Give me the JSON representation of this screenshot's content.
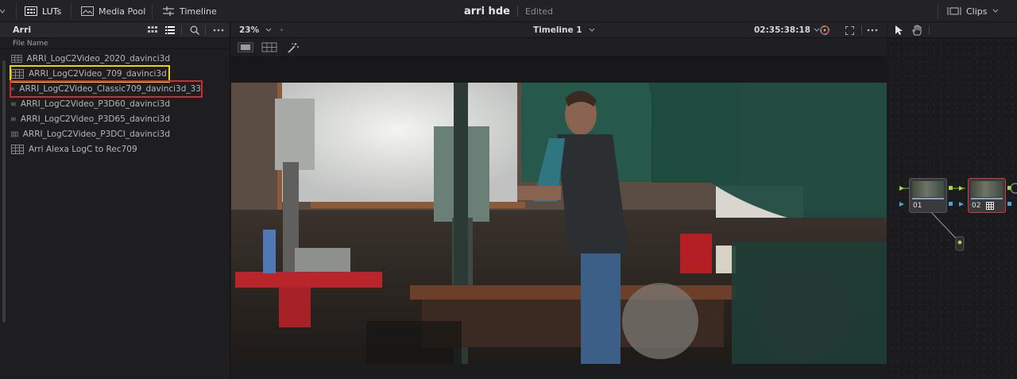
{
  "topbar": {
    "luts_label": "LUTs",
    "media_pool_label": "Media Pool",
    "timeline_label": "Timeline",
    "project_title": "arri hde",
    "project_status": "Edited",
    "clips_label": "Clips"
  },
  "left_panel": {
    "bin_name": "Arri",
    "column_header": "File Name",
    "files": [
      {
        "name": "ARRI_LogC2Video_2020_davinci3d",
        "highlight": "none"
      },
      {
        "name": "ARRI_LogC2Video_709_davinci3d",
        "highlight": "yellow"
      },
      {
        "name": "ARRI_LogC2Video_Classic709_davinci3d_33",
        "highlight": "red"
      },
      {
        "name": "ARRI_LogC2Video_P3D60_davinci3d",
        "highlight": "none"
      },
      {
        "name": "ARRI_LogC2Video_P3D65_davinci3d",
        "highlight": "none"
      },
      {
        "name": "ARRI_LogC2Video_P3DCI_davinci3d",
        "highlight": "none"
      },
      {
        "name": "Arri Alexa LogC to Rec709",
        "highlight": "none"
      }
    ]
  },
  "viewer": {
    "zoom": "23%",
    "timeline_name": "Timeline 1",
    "timecode": "02:35:38:18"
  },
  "nodes": [
    {
      "label": "01",
      "selected": false
    },
    {
      "label": "02",
      "selected": true
    }
  ],
  "colors": {
    "highlight_yellow": "#e8d31b",
    "highlight_red": "#d42a2a",
    "selected_node_border": "#d23a3a"
  }
}
